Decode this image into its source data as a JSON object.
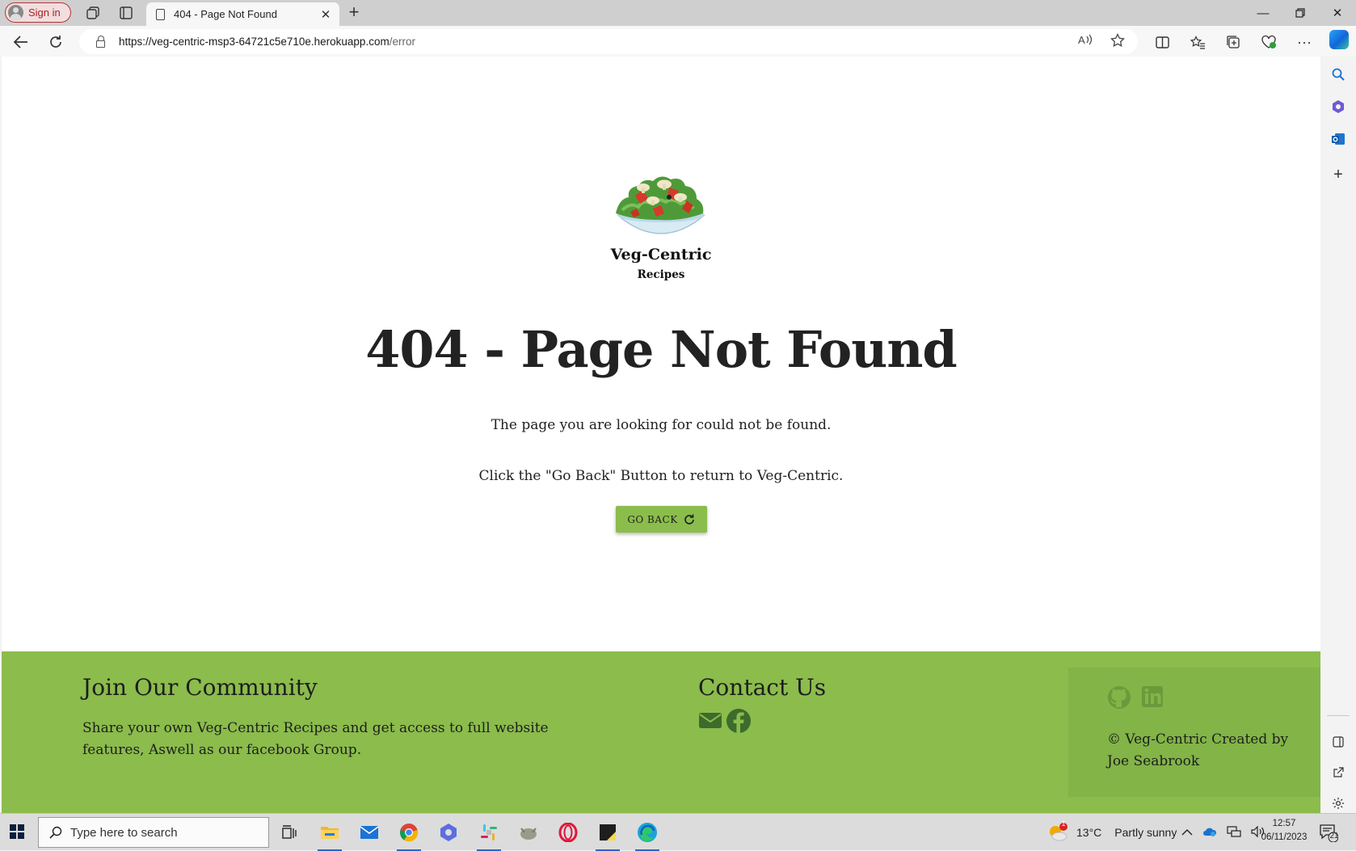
{
  "browser": {
    "signin_label": "Sign in",
    "tab_title": "404 - Page Not Found",
    "url_host": "https://veg-centric-msp3-64721c5e710e.herokuapp.com",
    "url_path": "/error"
  },
  "page": {
    "brand_name": "Veg-Centric",
    "brand_sub": "Recipes",
    "error_title": "404 - Page Not Found",
    "message_1": "The page you are looking for could not be found.",
    "message_2": "Click the \"Go Back\" Button to return to Veg-Centric.",
    "go_back_label": "GO BACK",
    "accent_color": "#8bbc4c"
  },
  "footer": {
    "community_title": "Join Our Community",
    "community_text_line1": "Share your own Veg-Centric Recipes and get access to full website",
    "community_text_line2": "features, Aswell as our facebook Group.",
    "contact_title": "Contact Us",
    "contact_icons": [
      "envelope-icon",
      "facebook-icon"
    ],
    "dev_icons": [
      "github-icon",
      "linkedin-icon"
    ],
    "credit_line1": "© Veg-Centric Created by",
    "credit_line2": "Joe Seabrook"
  },
  "taskbar": {
    "search_placeholder": "Type here to search",
    "weather_temp": "13°C",
    "weather_desc": "Partly sunny",
    "weather_badge": "1",
    "time": "12:57",
    "date": "06/11/2023",
    "notification_count": "21"
  }
}
